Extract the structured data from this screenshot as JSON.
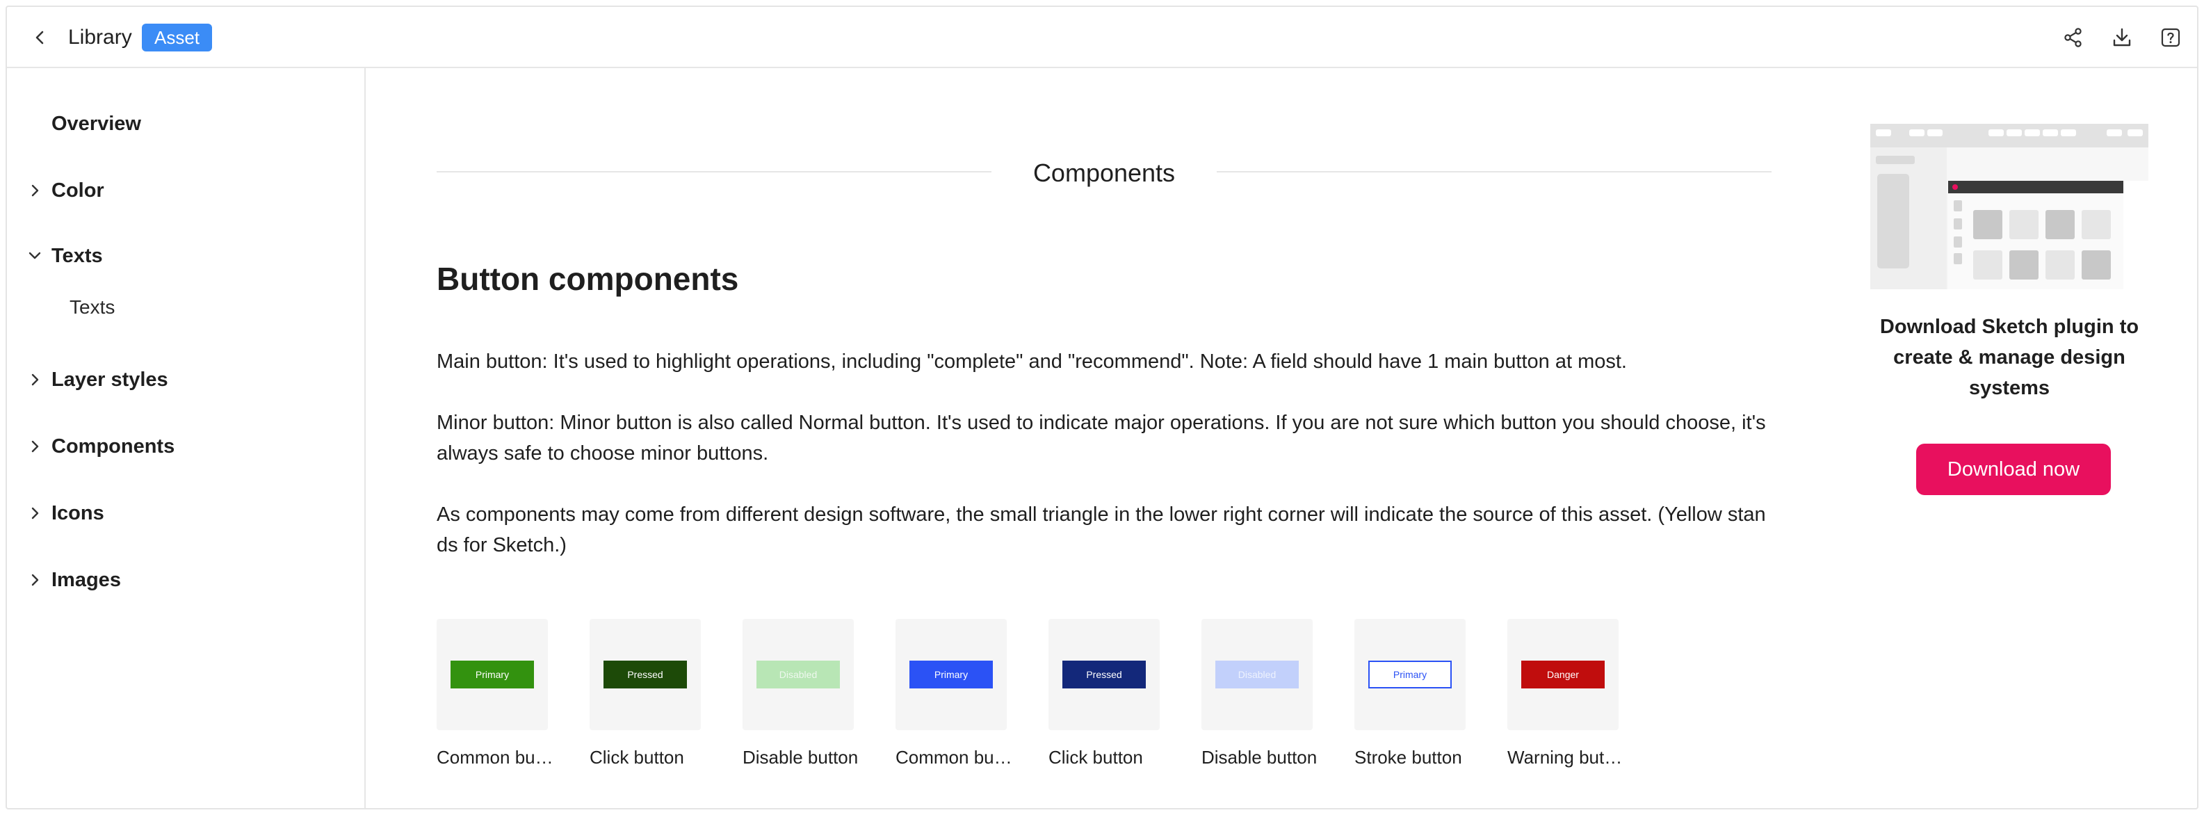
{
  "header": {
    "breadcrumb": "Library",
    "badge": "Asset"
  },
  "sidebar": {
    "items": [
      {
        "label": "Overview"
      },
      {
        "label": "Color"
      },
      {
        "label": "Texts",
        "children": [
          "Texts"
        ]
      },
      {
        "label": "Layer styles"
      },
      {
        "label": "Components"
      },
      {
        "label": "Icons"
      },
      {
        "label": "Images"
      }
    ]
  },
  "main": {
    "section_title": "Components",
    "heading": "Button components",
    "paragraphs": [
      "Main button: It's used to highlight operations, including \"complete\" and \"recommend\". Note: A field should have 1 main button at most.",
      "Minor button: Minor button is also called Normal button. It's used to indicate major operations. If you are not sure which button you should choose, it's always safe to choose minor buttons.",
      "As components may come from different design software, the small triangle in the lower right corner will indicate the source of this asset. (Yellow stands for Sketch.)"
    ],
    "cards": [
      {
        "sample": "Primary",
        "caption": "Common button",
        "bg": "#33920f",
        "fg": "#ffffff"
      },
      {
        "sample": "Pressed",
        "caption": "Click button",
        "bg": "#1d4a08",
        "fg": "#ffffff"
      },
      {
        "sample": "Disabled",
        "caption": "Disable button",
        "bg": "#b8e6b5",
        "fg": "#eef8ee"
      },
      {
        "sample": "Primary",
        "caption": "Common button",
        "bg": "#2b52f5",
        "fg": "#ffffff"
      },
      {
        "sample": "Pressed",
        "caption": "Click button",
        "bg": "#13287a",
        "fg": "#ffffff"
      },
      {
        "sample": "Disabled",
        "caption": "Disable button",
        "bg": "#c2d0fb",
        "fg": "#eef2fe"
      },
      {
        "sample": "Primary",
        "caption": "Stroke button",
        "bg": "#ffffff",
        "fg": "#2b52f5",
        "border": "#2b52f5"
      },
      {
        "sample": "Danger",
        "caption": "Warning button",
        "bg": "#c00d0d",
        "fg": "#ffffff"
      }
    ]
  },
  "right": {
    "promo": "Download Sketch plugin to create & manage design systems",
    "button": "Download now"
  },
  "colors": {
    "accent": "#3b8cf6",
    "download": "#e8105e"
  }
}
